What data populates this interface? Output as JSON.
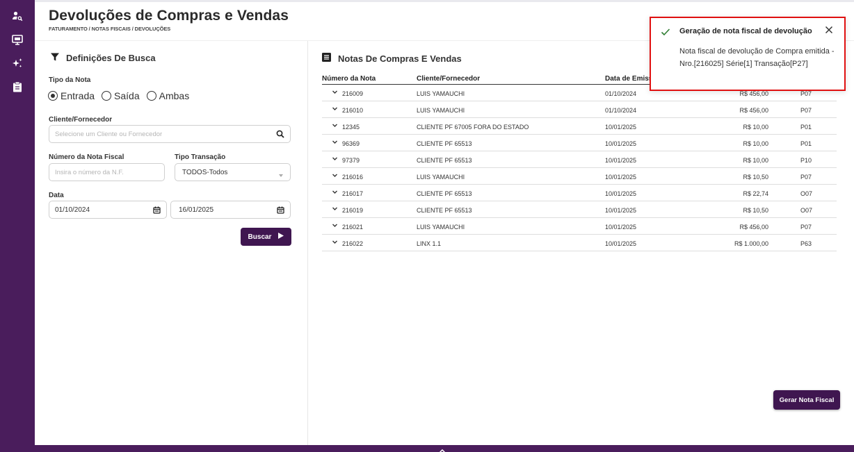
{
  "page": {
    "title": "Devoluções de Compras e Vendas",
    "breadcrumb": "FATURAMENTO / NOTAS FISCAIS / DEVOLUÇÕES"
  },
  "sidebar": {
    "icons": [
      "person-search-icon",
      "monitor-icon",
      "sparkles-icon",
      "clipboard-icon"
    ]
  },
  "search": {
    "title": "Definições De Busca",
    "tipo_nota_label": "Tipo da Nota",
    "options": [
      "Entrada",
      "Saída",
      "Ambas"
    ],
    "selected": "Entrada",
    "cliente_label": "Cliente/Fornecedor",
    "cliente_placeholder": "Selecione um Cliente ou Fornecedor",
    "numero_label": "Número da Nota Fiscal",
    "numero_placeholder": "Insira o número da N.F.",
    "tipo_transacao_label": "Tipo Transação",
    "tipo_transacao_value": "TODOS-Todos",
    "data_label": "Data",
    "data_inicio": "01/10/2024",
    "data_fim": "16/01/2025",
    "buscar_label": "Buscar"
  },
  "notas": {
    "title": "Notas De Compras E Vendas",
    "columns": [
      "Número da Nota",
      "Cliente/Fornecedor",
      "Data de Emissã"
    ],
    "rows": [
      {
        "numero": "216009",
        "cliente": "LUIS YAMAUCHI",
        "data": "01/10/2024",
        "valor": "R$ 456,00",
        "transacao": "P07"
      },
      {
        "numero": "216010",
        "cliente": "LUIS YAMAUCHI",
        "data": "01/10/2024",
        "valor": "R$ 456,00",
        "transacao": "P07"
      },
      {
        "numero": "12345",
        "cliente": "CLIENTE PF 67005 FORA DO ESTADO",
        "data": "10/01/2025",
        "valor": "R$ 10,00",
        "transacao": "P01"
      },
      {
        "numero": "96369",
        "cliente": "CLIENTE PF 65513",
        "data": "10/01/2025",
        "valor": "R$ 10,00",
        "transacao": "P01"
      },
      {
        "numero": "97379",
        "cliente": "CLIENTE PF 65513",
        "data": "10/01/2025",
        "valor": "R$ 10,00",
        "transacao": "P10"
      },
      {
        "numero": "216016",
        "cliente": "LUIS YAMAUCHI",
        "data": "10/01/2025",
        "valor": "R$ 10,50",
        "transacao": "P07"
      },
      {
        "numero": "216017",
        "cliente": "CLIENTE PF 65513",
        "data": "10/01/2025",
        "valor": "R$ 22,74",
        "transacao": "O07"
      },
      {
        "numero": "216019",
        "cliente": "CLIENTE PF 65513",
        "data": "10/01/2025",
        "valor": "R$ 10,50",
        "transacao": "O07"
      },
      {
        "numero": "216021",
        "cliente": "LUIS YAMAUCHI",
        "data": "10/01/2025",
        "valor": "R$ 456,00",
        "transacao": "P07"
      },
      {
        "numero": "216022",
        "cliente": "LINX 1.1",
        "data": "10/01/2025",
        "valor": "R$ 1.000,00",
        "transacao": "P63"
      }
    ]
  },
  "toast": {
    "title": "Geração de nota fiscal de devolução",
    "message": "Nota fiscal de devolução de Compra emitida - Nro.[216025] Série[1] Transação[P27]"
  },
  "actions": {
    "gerar_label": "Gerar Nota Fiscal"
  },
  "colors": {
    "brand": "#4a1d5c",
    "button": "#3f1650",
    "toast_border": "#e01010",
    "success": "#2e7d32"
  }
}
